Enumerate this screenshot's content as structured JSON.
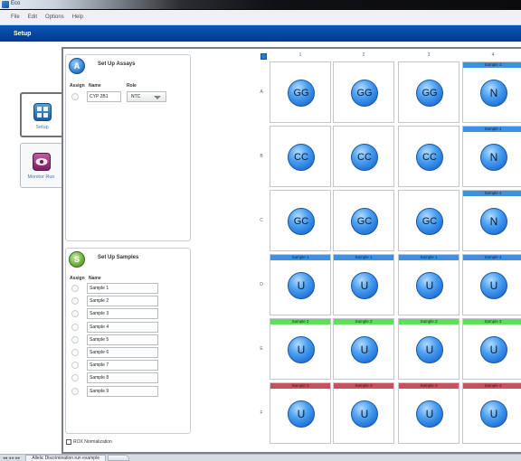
{
  "window": {
    "title": "Eco"
  },
  "menu": [
    "File",
    "Edit",
    "Options",
    "Help"
  ],
  "header": {
    "title": "Setup"
  },
  "nav": [
    {
      "label": "Setup",
      "active": true
    },
    {
      "label": "Monitor Run",
      "active": false
    }
  ],
  "assays": {
    "badge": "A",
    "title": "Set Up Assays",
    "columns": [
      "Assign",
      "Name",
      "Role"
    ],
    "rows": [
      {
        "name": "CYP 2B1",
        "role": "NTC"
      }
    ]
  },
  "samples": {
    "badge": "S",
    "title": "Set Up Samples",
    "columns": [
      "Assign",
      "Name"
    ],
    "items": [
      "Sample 1",
      "Sample 2",
      "Sample 3",
      "Sample 4",
      "Sample 5",
      "Sample 6",
      "Sample 7",
      "Sample 8",
      "Sample 9"
    ]
  },
  "rox": {
    "label": "ROX Normalization",
    "checked": false
  },
  "plate": {
    "columns": [
      "1",
      "2",
      "3",
      "4"
    ],
    "rows": [
      {
        "label": "A",
        "wells": [
          {
            "call": "GG",
            "sample": ""
          },
          {
            "call": "GG",
            "sample": ""
          },
          {
            "call": "GG",
            "sample": ""
          },
          {
            "call": "N",
            "sample": "Sample 1"
          }
        ]
      },
      {
        "label": "B",
        "wells": [
          {
            "call": "CC",
            "sample": ""
          },
          {
            "call": "CC",
            "sample": ""
          },
          {
            "call": "CC",
            "sample": ""
          },
          {
            "call": "N",
            "sample": "Sample 1"
          }
        ]
      },
      {
        "label": "C",
        "wells": [
          {
            "call": "GC",
            "sample": ""
          },
          {
            "call": "GC",
            "sample": ""
          },
          {
            "call": "GC",
            "sample": ""
          },
          {
            "call": "N",
            "sample": "Sample 1"
          }
        ]
      },
      {
        "label": "D",
        "wells": [
          {
            "call": "U",
            "sample": "Sample 1"
          },
          {
            "call": "U",
            "sample": "Sample 1"
          },
          {
            "call": "U",
            "sample": "Sample 1"
          },
          {
            "call": "U",
            "sample": "Sample 1"
          }
        ]
      },
      {
        "label": "E",
        "wells": [
          {
            "call": "U",
            "sample": "Sample 2"
          },
          {
            "call": "U",
            "sample": "Sample 2"
          },
          {
            "call": "U",
            "sample": "Sample 2"
          },
          {
            "call": "U",
            "sample": "Sample 2"
          }
        ]
      },
      {
        "label": "F",
        "wells": [
          {
            "call": "U",
            "sample": "Sample 3"
          },
          {
            "call": "U",
            "sample": "Sample 3"
          },
          {
            "call": "U",
            "sample": "Sample 3"
          },
          {
            "call": "U",
            "sample": "Sample 3"
          }
        ]
      }
    ],
    "sample_colors": {
      "Sample 1": "#3f8fe6",
      "Sample 2": "#5de05a",
      "Sample 3": "#c9505e"
    }
  },
  "tabs": [
    {
      "label": "Allelic Discrimination run example"
    }
  ]
}
